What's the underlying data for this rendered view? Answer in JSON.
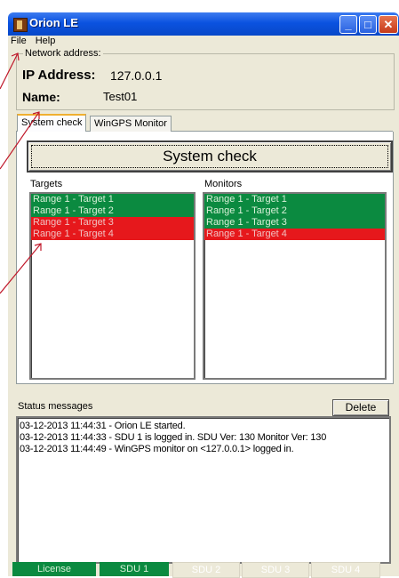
{
  "window": {
    "title": "Orion LE"
  },
  "menu": {
    "items": [
      "File",
      "Help"
    ]
  },
  "network": {
    "legend": "Network address:",
    "ip_label": "IP Address:",
    "ip_value": "127.0.0.1",
    "name_label": "Name:",
    "name_value": "Test01"
  },
  "tabs": [
    {
      "label": "System check",
      "active": true
    },
    {
      "label": "WinGPS Monitor",
      "active": false
    }
  ],
  "system_check": {
    "button_label": "System check",
    "targets_header": "Targets",
    "monitors_header": "Monitors",
    "targets": [
      {
        "label": "Range 1 - Target 1",
        "status": "green"
      },
      {
        "label": "Range 1 - Target 2",
        "status": "green"
      },
      {
        "label": "Range 1 - Target 3",
        "status": "red"
      },
      {
        "label": "Range 1 - Target 4",
        "status": "red"
      }
    ],
    "monitors": [
      {
        "label": "Range 1 - Target 1",
        "status": "green"
      },
      {
        "label": "Range 1 - Target 2",
        "status": "green"
      },
      {
        "label": "Range 1 - Target 3",
        "status": "green"
      },
      {
        "label": "Range 1 - Target 4",
        "status": "red"
      }
    ]
  },
  "status": {
    "label": "Status messages",
    "delete_label": "Delete",
    "messages": [
      "03-12-2013 11:44:31 - Orion LE started.",
      "03-12-2013 11:44:33 - SDU 1 is logged in. SDU Ver: 130 Monitor Ver: 130",
      "03-12-2013 11:44:49 - WinGPS monitor on <127.0.0.1> logged in."
    ]
  },
  "statusbar": [
    {
      "label": "License",
      "active": true
    },
    {
      "label": "SDU 1",
      "active": true
    },
    {
      "label": "SDU 2",
      "active": false
    },
    {
      "label": "SDU 3",
      "active": false
    },
    {
      "label": "SDU 4",
      "active": false
    }
  ],
  "colors": {
    "ok": "#0b8a40",
    "error": "#e6181c",
    "titlebar": "#0a52e0",
    "annotation": "#c0182a"
  }
}
